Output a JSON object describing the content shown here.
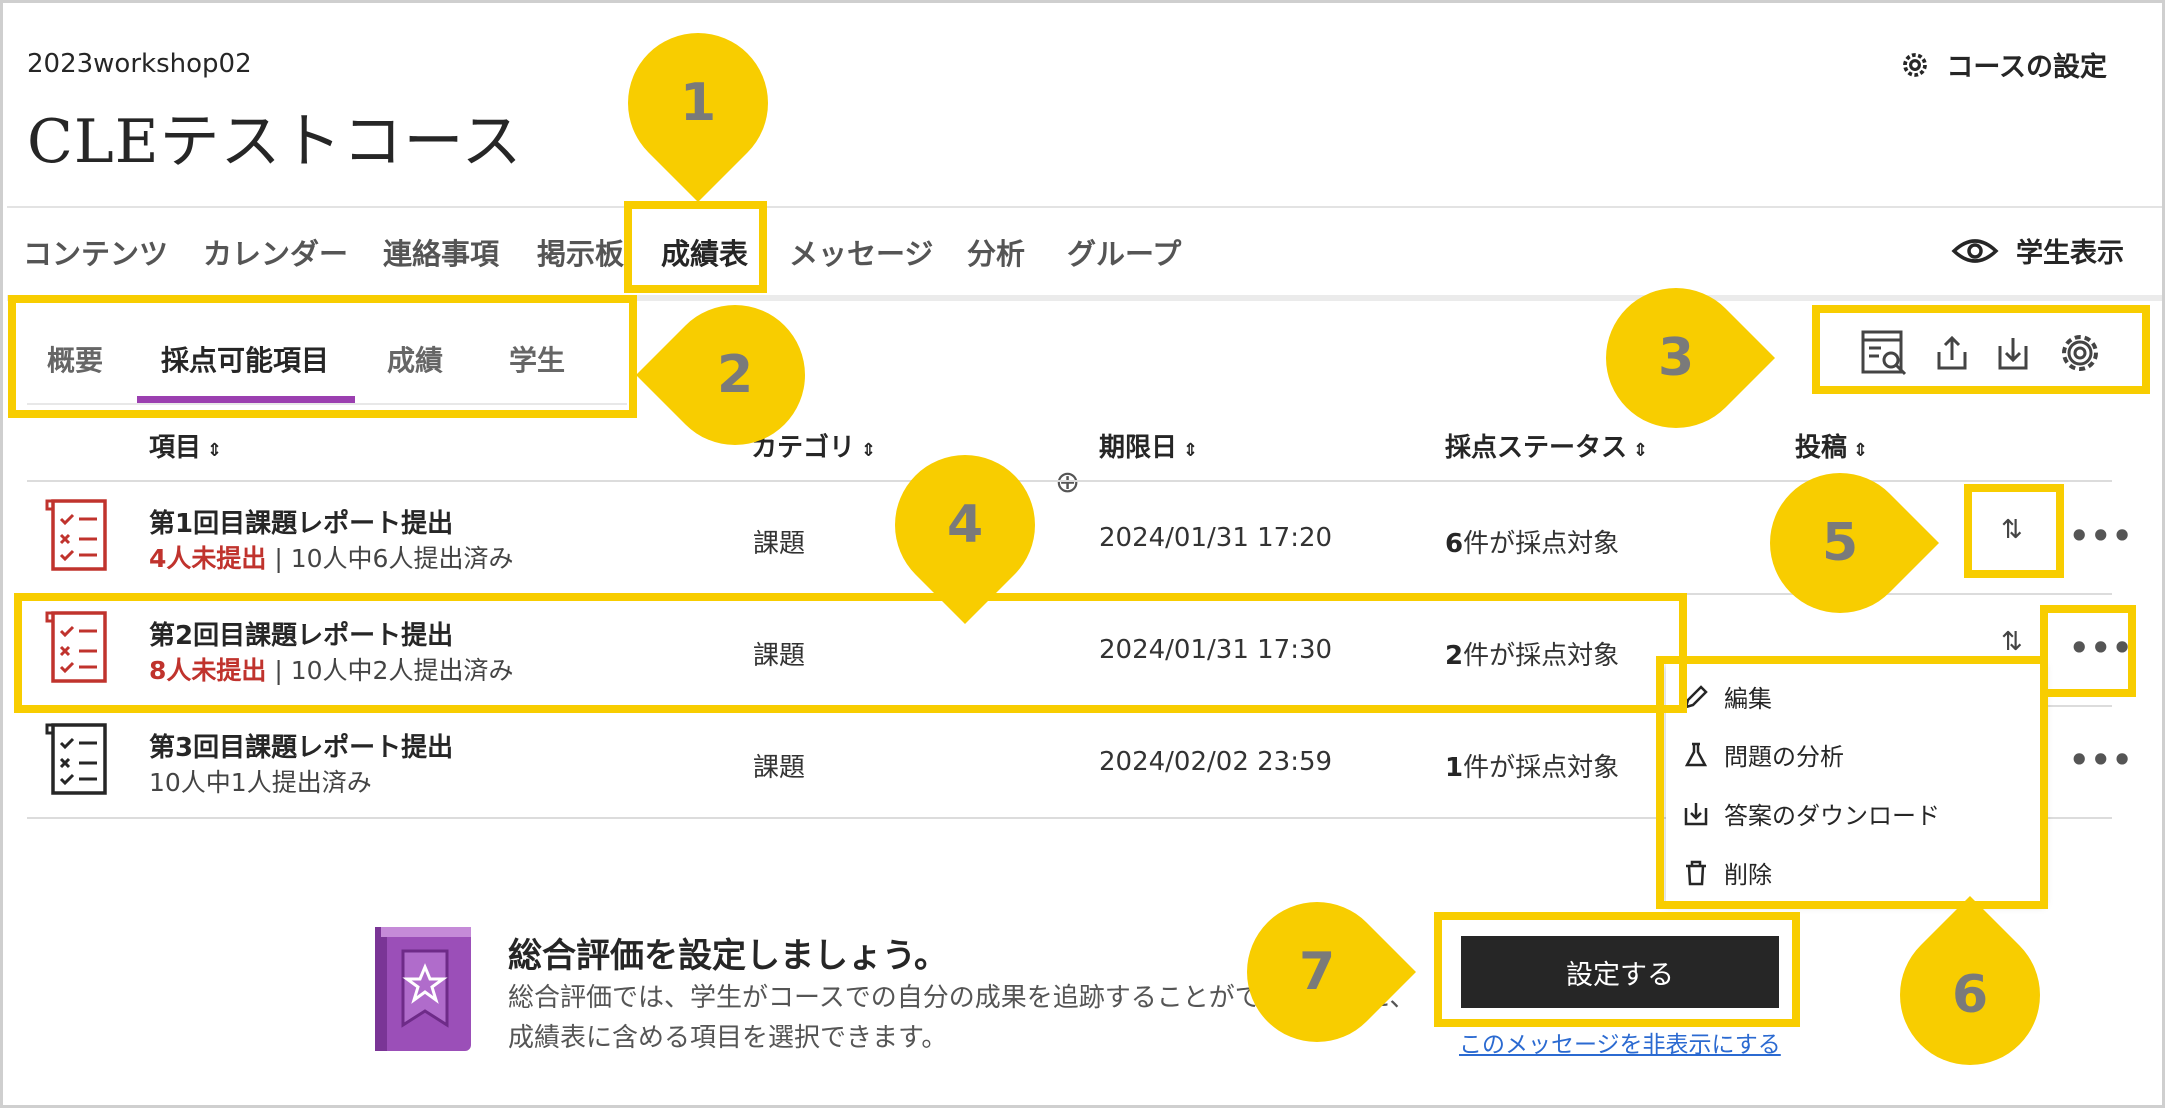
{
  "header": {
    "course_id": "2023workshop02",
    "course_title": "CLEテストコース",
    "course_settings_label": "コースの設定"
  },
  "nav": {
    "tabs": [
      "コンテンツ",
      "カレンダー",
      "連絡事項",
      "掲示板",
      "成績表",
      "メッセージ",
      "分析",
      "グループ"
    ],
    "active_tab": "成績表",
    "student_view_label": "学生表示"
  },
  "subtabs": {
    "items": [
      "概要",
      "採点可能項目",
      "成績",
      "学生"
    ],
    "active": "採点可能項目"
  },
  "toolbar": {
    "icons": [
      "grading-search-icon",
      "upload-icon",
      "download-icon",
      "gear-icon"
    ]
  },
  "table": {
    "columns": [
      "項目",
      "カテゴリ",
      "期限日",
      "採点ステータス",
      "投稿"
    ],
    "sort_glyph": "⇕",
    "rows": [
      {
        "title": "第1回目課題レポート提出",
        "unsubmitted": "4人未提出",
        "submitted": "10人中6人提出済み",
        "category": "課題",
        "due": "2024/01/31 17:20",
        "status_count": "6",
        "status_text": "件が採点対象"
      },
      {
        "title": "第2回目課題レポート提出",
        "unsubmitted": "8人未提出",
        "submitted": "10人中2人提出済み",
        "category": "課題",
        "due": "2024/01/31 17:30",
        "status_count": "2",
        "status_text": "件が採点対象"
      },
      {
        "title": "第3回目課題レポート提出",
        "unsubmitted": "",
        "submitted": "10人中1人提出済み",
        "category": "課題",
        "due": "2024/02/02 23:59",
        "status_count": "1",
        "status_text": "件が採点対象"
      }
    ],
    "separator": "|",
    "more_label": "•••",
    "sort_label": "⇅",
    "add_column_label": "⊕"
  },
  "menu": {
    "items": [
      {
        "label": "編集",
        "icon": "pencil-icon"
      },
      {
        "label": "問題の分析",
        "icon": "flask-icon"
      },
      {
        "label": "答案のダウンロード",
        "icon": "download-icon"
      },
      {
        "label": "削除",
        "icon": "trash-icon"
      }
    ]
  },
  "banner": {
    "title": "総合評価を設定しましょう。",
    "text": "総合評価では、学生がコースでの自分の成果を追跡することができるように、成績表に含める項目を選択できます。",
    "button_label": "設定する",
    "hide_link": "このメッセージを非表示にする"
  },
  "annotations": [
    "1",
    "2",
    "3",
    "4",
    "5",
    "6",
    "7"
  ],
  "colors": {
    "highlight": "#f8cd00",
    "active_tab_underline": "#9b3fb0",
    "unsubmitted": "#c0332d",
    "link": "#2b6ad1"
  }
}
